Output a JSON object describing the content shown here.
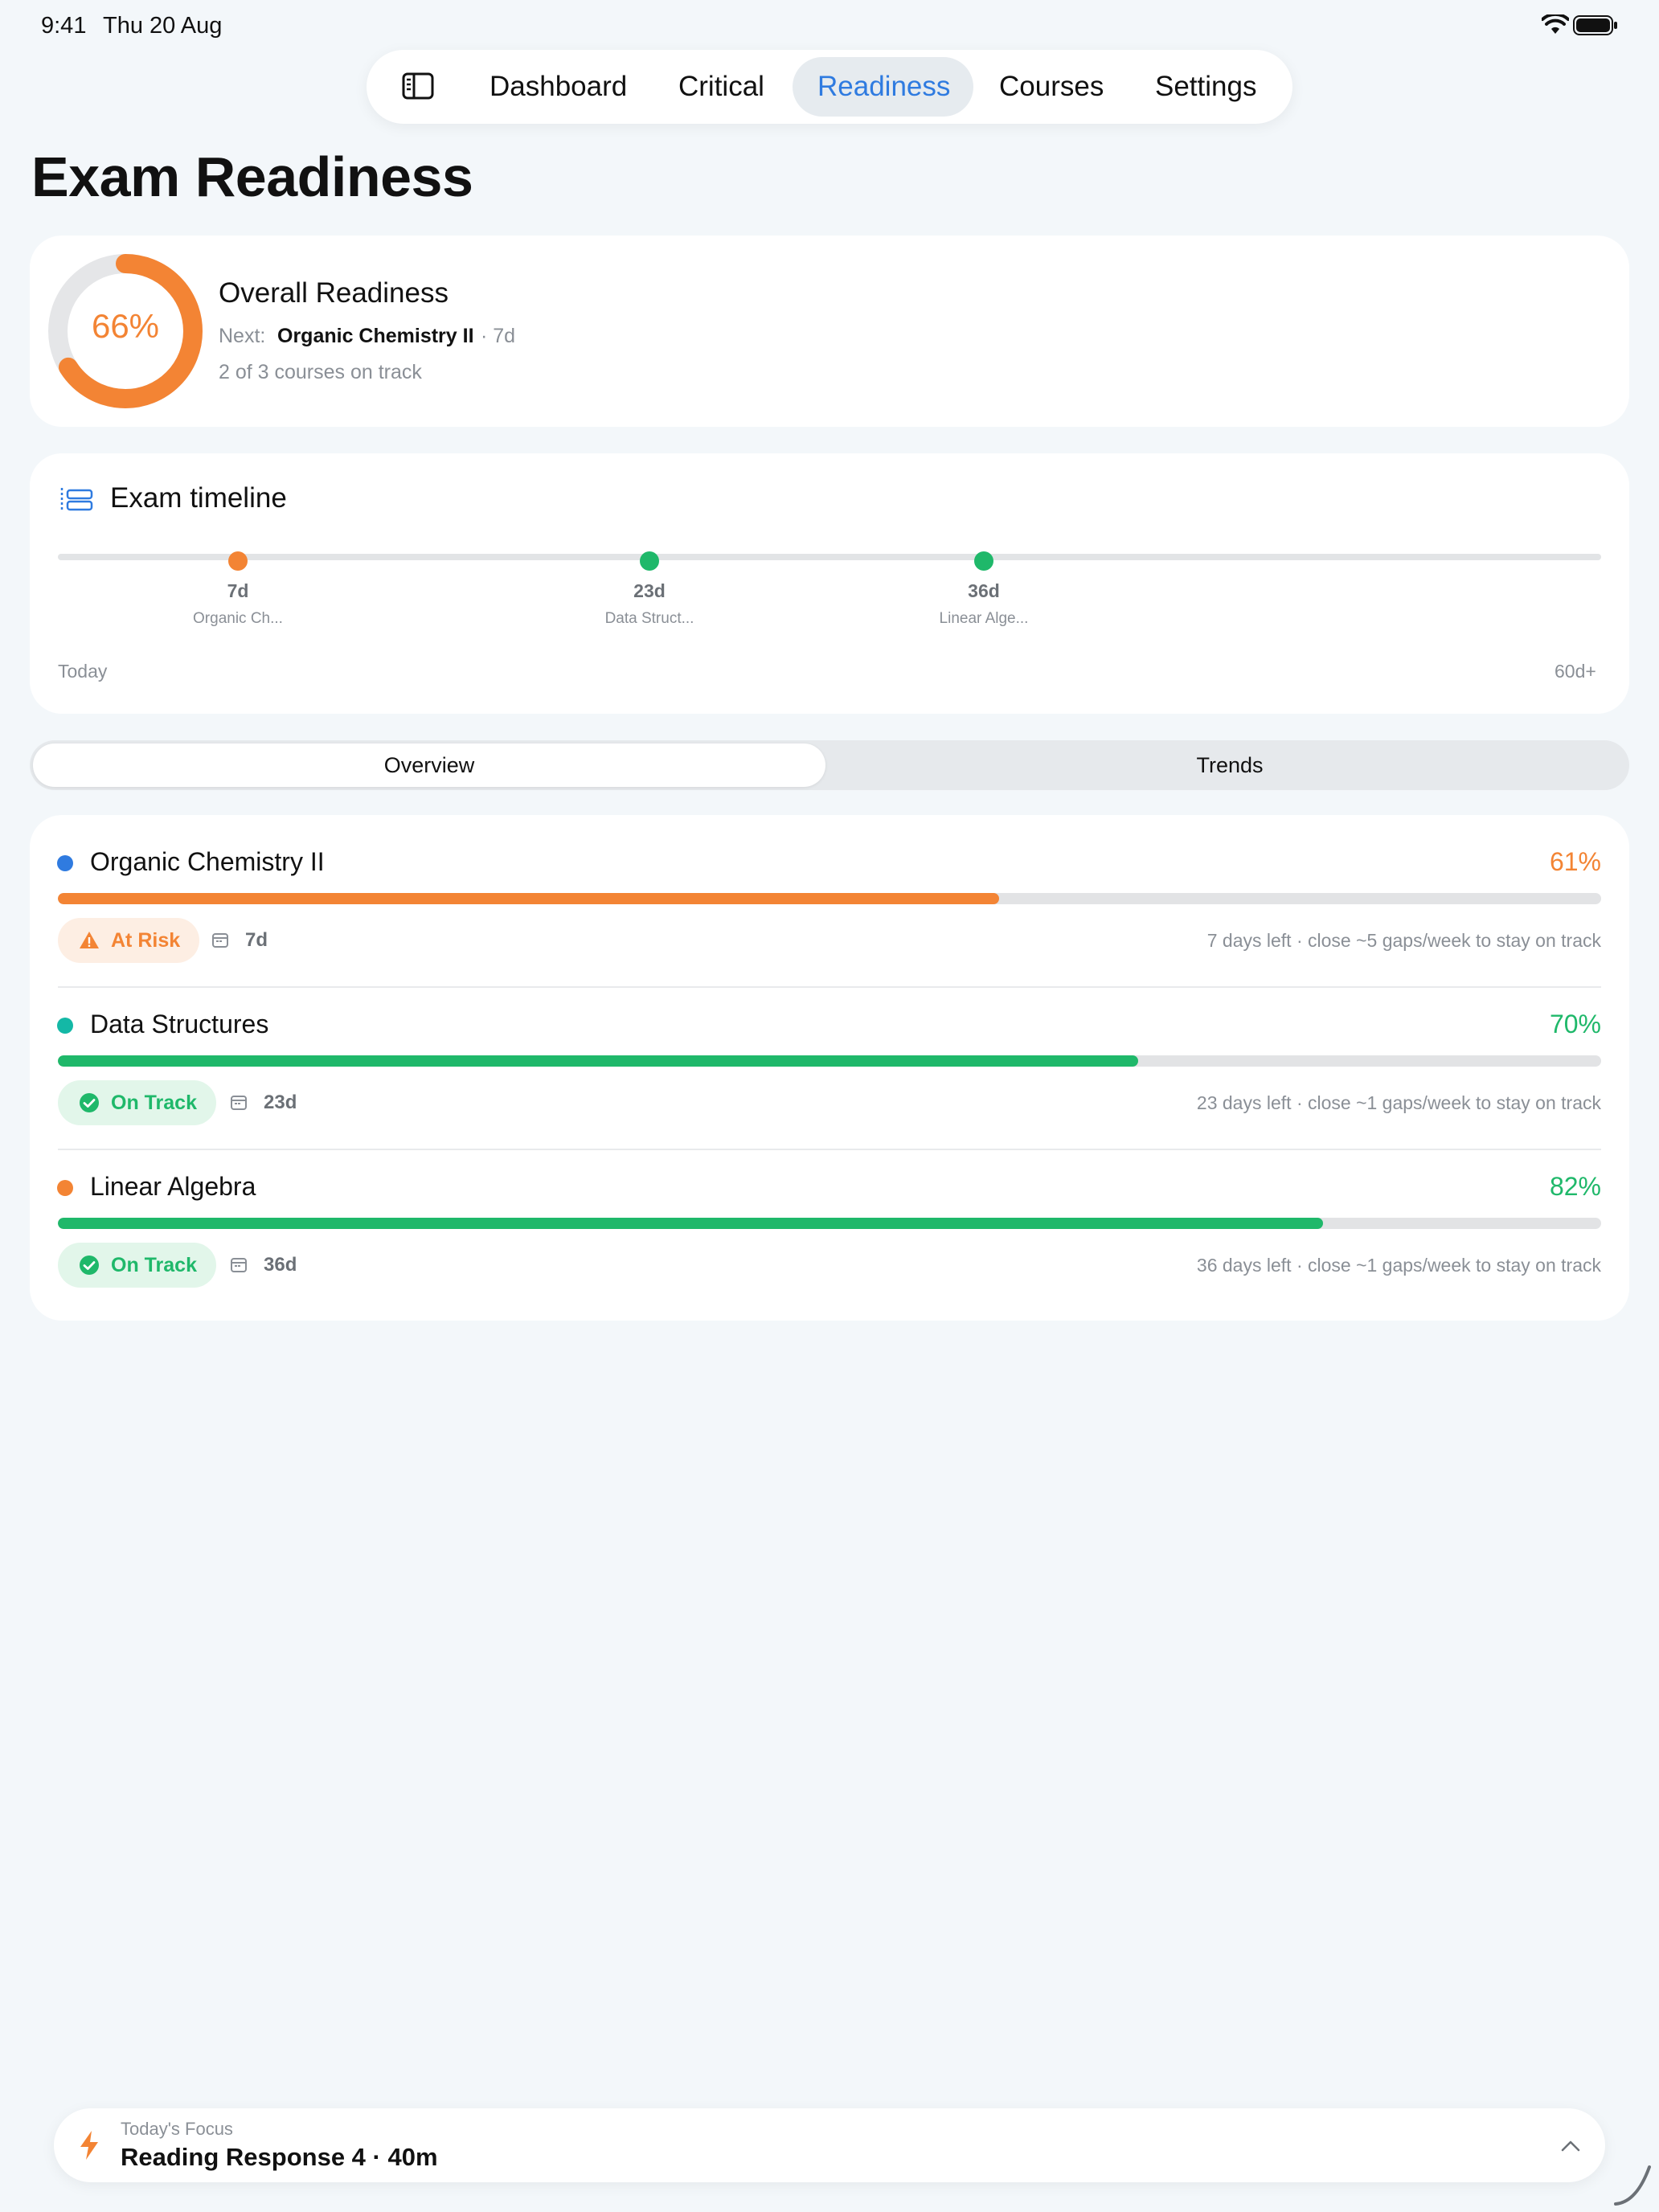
{
  "status": {
    "time": "9:41",
    "date": "Thu 20 Aug"
  },
  "nav": {
    "items": [
      "Dashboard",
      "Critical",
      "Readiness",
      "Courses",
      "Settings"
    ],
    "active": "Readiness"
  },
  "page": {
    "title": "Exam Readiness"
  },
  "overall": {
    "percent_label": "66%",
    "percent": 66,
    "title": "Overall Readiness",
    "next_label": "Next:",
    "next_course": "Organic Chemistry II",
    "next_days": "· 7d",
    "summary": "2 of 3 courses on track"
  },
  "timeline": {
    "title": "Exam timeline",
    "start_label": "Today",
    "end_label": "60d+",
    "events": [
      {
        "days": "7d",
        "name": "Organic Ch...",
        "color": "#f38434"
      },
      {
        "days": "23d",
        "name": "Data Struct...",
        "color": "#1fb86a"
      },
      {
        "days": "36d",
        "name": "Linear Alge...",
        "color": "#1fb86a"
      }
    ]
  },
  "segments": {
    "overview": "Overview",
    "trends": "Trends",
    "active": "Overview"
  },
  "courses": [
    {
      "name": "Organic Chemistry II",
      "dot_color": "#2f7be0",
      "percent_label": "61%",
      "percent": 61,
      "bar_color": "#f38434",
      "status": "At Risk",
      "status_color": "#f38434",
      "status_bg": "#fdeee3",
      "days": "7d",
      "note": "7 days left · close ~5 gaps/week to stay on track"
    },
    {
      "name": "Data Structures",
      "dot_color": "#14b8a6",
      "percent_label": "70%",
      "percent": 70,
      "bar_color": "#1fb86a",
      "status": "On Track",
      "status_color": "#1fb86a",
      "status_bg": "#e2f6ea",
      "days": "23d",
      "note": "23 days left · close ~1 gaps/week to stay on track"
    },
    {
      "name": "Linear Algebra",
      "dot_color": "#f38434",
      "percent_label": "82%",
      "percent": 82,
      "bar_color": "#1fb86a",
      "status": "On Track",
      "status_color": "#1fb86a",
      "status_bg": "#e2f6ea",
      "days": "36d",
      "note": "36 days left · close ~1 gaps/week to stay on track"
    }
  ],
  "focus": {
    "label": "Today's Focus",
    "title": "Reading Response 4 · 40m"
  },
  "colors": {
    "accent": "#2f7be0",
    "warning": "#f38434",
    "success": "#1fb86a"
  }
}
